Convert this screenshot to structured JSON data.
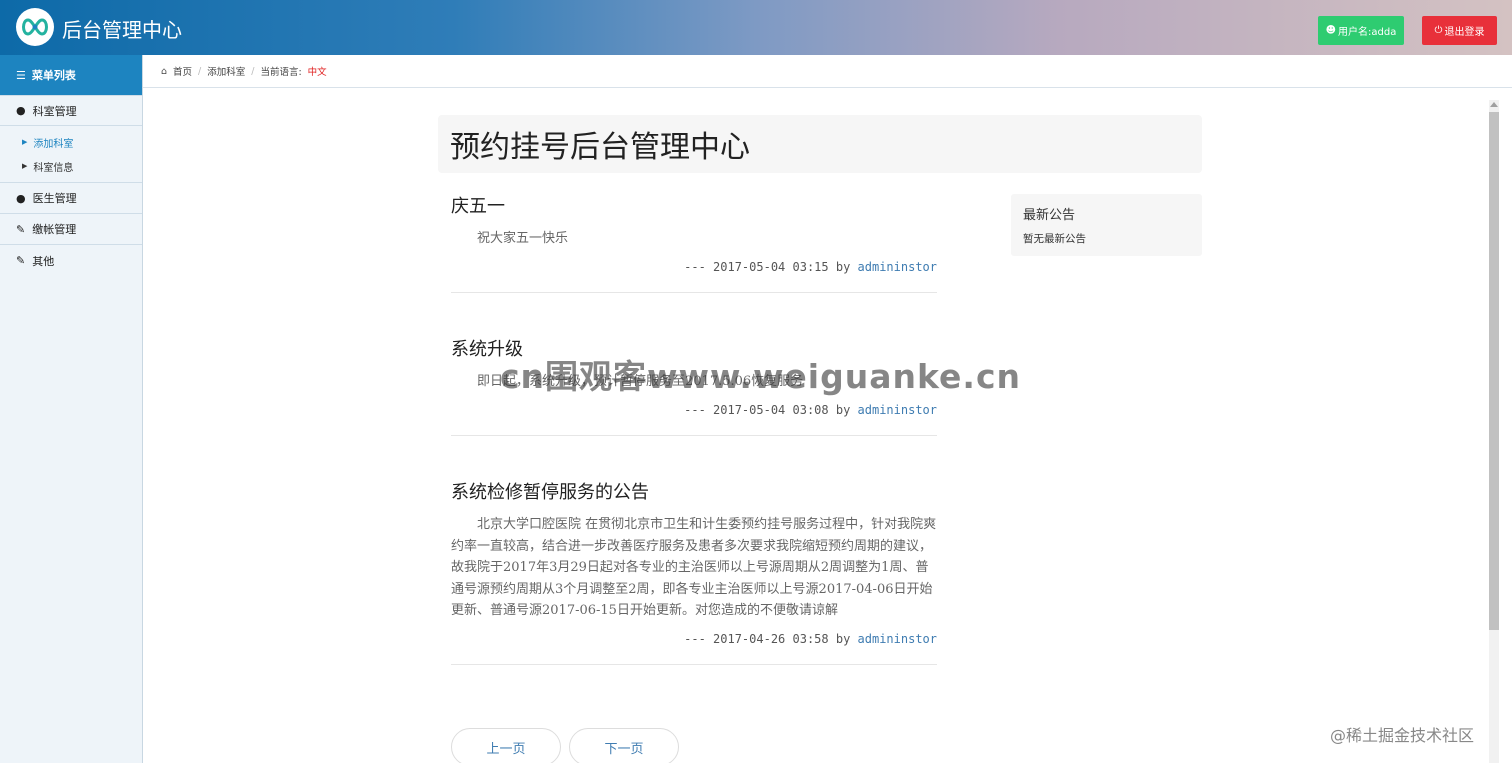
{
  "header": {
    "brand": "后台管理中心",
    "user_label": "用户名:adda",
    "logout_label": "退出登录"
  },
  "sidebar": {
    "title": "菜单列表",
    "groups": [
      {
        "label": "科室管理",
        "icon": "user-icon",
        "children": [
          {
            "label": "添加科室",
            "active": true
          },
          {
            "label": "科室信息",
            "active": false
          }
        ]
      },
      {
        "label": "医生管理",
        "icon": "user-icon"
      },
      {
        "label": "缴帐管理",
        "icon": "edit-icon"
      },
      {
        "label": "其他",
        "icon": "edit-icon"
      }
    ]
  },
  "breadcrumb": {
    "home": "首页",
    "current": "添加科室",
    "lang_prefix": "当前语言:",
    "lang": "中文"
  },
  "main": {
    "title": "预约挂号后台管理中心",
    "posts": [
      {
        "title": "庆五一",
        "body": "祝大家五一快乐",
        "date_prefix": "--- 2017-05-04 03:15 by ",
        "author": "admininstor"
      },
      {
        "title": "系统升级",
        "body": "即日起，系统升级，预计暂停服务至2017.5.06恢复服务",
        "date_prefix": "--- 2017-05-04 03:08 by ",
        "author": "admininstor"
      },
      {
        "title": "系统检修暂停服务的公告",
        "body": "北京大学口腔医院 在贯彻北京市卫生和计生委预约挂号服务过程中，针对我院爽约率一直较高，结合进一步改善医疗服务及患者多次要求我院缩短预约周期的建议，故我院于2017年3月29日起对各专业的主治医师以上号源周期从2周调整为1周、普通号源预约周期从3个月调整至2周，即各专业主治医师以上号源2017-04-06日开始更新、普通号源2017-06-15日开始更新。对您造成的不便敬请谅解",
        "date_prefix": "--- 2017-04-26 03:58 by ",
        "author": "admininstor"
      }
    ],
    "notice": {
      "title": "最新公告",
      "text": "暂无最新公告"
    },
    "pager": {
      "prev": "上一页",
      "next": "下一页"
    }
  },
  "overlay": {
    "watermark": "cn围观客www.weiguanke.cn",
    "credit": "@稀土掘金技术社区"
  },
  "colors": {
    "accent": "#1d84c0",
    "user_button": "#2ecc71",
    "logout_button": "#e8303a",
    "link": "#3f7cb1"
  }
}
